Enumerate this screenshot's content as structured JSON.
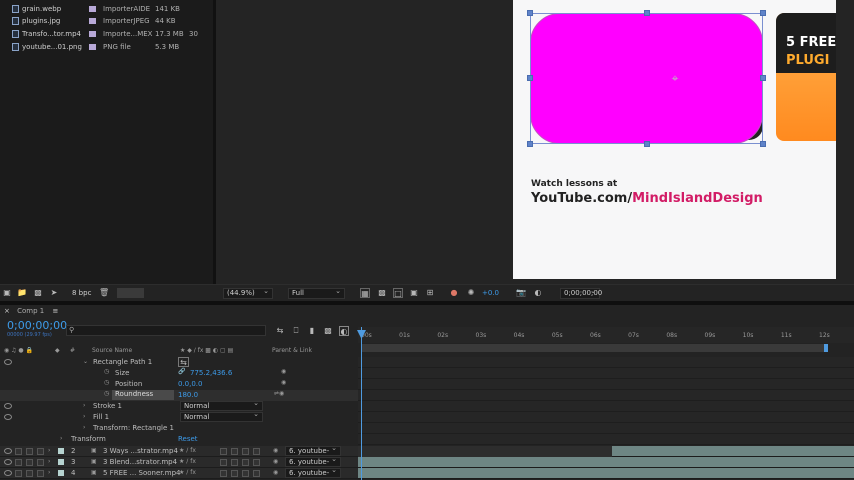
{
  "project": {
    "items": [
      {
        "name": "grain.webp",
        "type": "ImporterAIDE",
        "size": "141 KB",
        "fr": ""
      },
      {
        "name": "plugins.jpg",
        "type": "ImporterJPEG",
        "size": "44 KB",
        "fr": ""
      },
      {
        "name": "Transfo...tor.mp4",
        "type": "Importe...MEX",
        "size": "17.3 MB",
        "fr": "30"
      },
      {
        "name": "youtube...01.png",
        "type": "PNG file",
        "size": "5.3 MB",
        "fr": ""
      }
    ],
    "bpc": "8 bpc"
  },
  "viewer": {
    "watch_text": "Watch lessons at",
    "yt_prefix": "YouTube.com/",
    "yt_name": "MindIslandDesign",
    "banner_line1": "5 FREE",
    "banner_line2": "PLUGI",
    "zoom": "(44.9%)",
    "resolution": "Full",
    "exposure": "+0.0",
    "timecode": "0;00;00;00"
  },
  "timeline": {
    "tab_label": "Comp 1",
    "current_time": "0;00;00;00",
    "fps_info": "00000 (29.97 fps)",
    "columns": {
      "source_name": "Source Name",
      "parent_link": "Parent & Link"
    },
    "ticks": [
      "00s",
      "01s",
      "02s",
      "03s",
      "04s",
      "05s",
      "06s",
      "07s",
      "08s",
      "09s",
      "10s",
      "11s",
      "12s"
    ],
    "props": {
      "rect_path": "Rectangle Path 1",
      "size_label": "Size",
      "size_value": "775.2,436.6",
      "position_label": "Position",
      "position_value": "0.0,0.0",
      "roundness_label": "Roundness",
      "roundness_value": "180.0",
      "stroke_label": "Stroke 1",
      "stroke_mode": "Normal",
      "fill_label": "Fill 1",
      "fill_mode": "Normal",
      "transform_rect": "Transform: Rectangle 1",
      "transform_label": "Transform",
      "reset_label": "Reset"
    },
    "layers": [
      {
        "num": "2",
        "name": "3 Ways ...strator.mp4",
        "parent": "6. youtube-"
      },
      {
        "num": "3",
        "name": "3 Blend...strator.mp4",
        "parent": "6. youtube-"
      },
      {
        "num": "4",
        "name": "5 FREE ... Sooner.mp4",
        "parent": "6. youtube-"
      }
    ]
  }
}
